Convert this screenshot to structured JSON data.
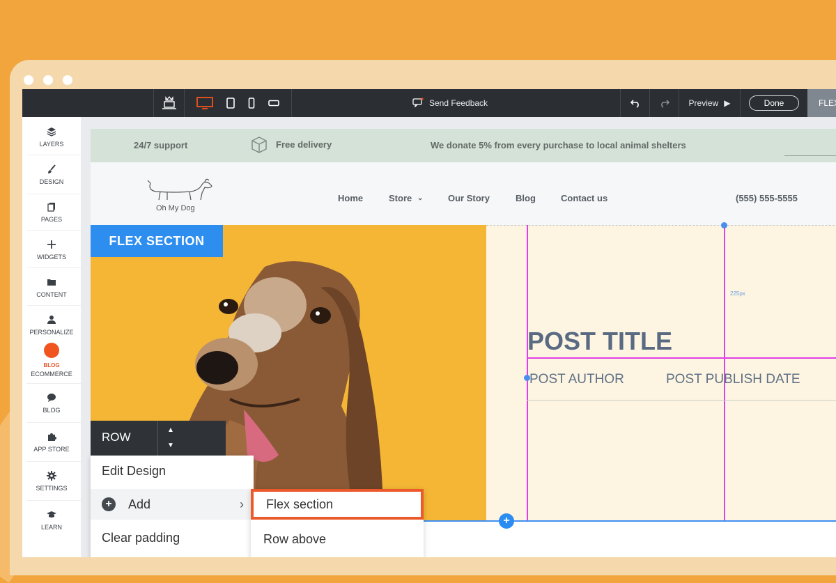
{
  "toolbar": {
    "feedback_label": "Send Feedback",
    "preview_label": "Preview",
    "done_label": "Done",
    "flex_tab_label": "FLEX",
    "device_icons": [
      "crown-desktop-icon",
      "desktop-icon",
      "tablet-icon",
      "mobile-icon",
      "landscape-icon"
    ],
    "active_device": "desktop",
    "accent_color": "#f0541f"
  },
  "sidebar": {
    "items": [
      {
        "label": "LAYERS",
        "icon": "layers-icon"
      },
      {
        "label": "DESIGN",
        "icon": "brush-icon"
      },
      {
        "label": "PAGES",
        "icon": "pages-icon"
      },
      {
        "label": "WIDGETS",
        "icon": "plus-icon"
      },
      {
        "label": "CONTENT",
        "icon": "folder-icon"
      },
      {
        "label": "PERSONALIZE",
        "icon": "person-icon"
      },
      {
        "label": "ECOMMERCE",
        "icon": "cart-icon"
      },
      {
        "label": "BLOG",
        "icon": "chat-bubble-icon"
      },
      {
        "label": "APP STORE",
        "icon": "puzzle-icon"
      },
      {
        "label": "SETTINGS",
        "icon": "gear-icon"
      },
      {
        "label": "LEARN",
        "icon": "graduation-cap-icon"
      }
    ],
    "blog_badge_label": "BLOG"
  },
  "site": {
    "topbar": {
      "support": "24/7 support",
      "delivery": "Free delivery",
      "donate": "We donate 5% from every purchase to local animal shelters"
    },
    "logo_text": "Oh My Dog",
    "nav": [
      "Home",
      "Store",
      "Our Story",
      "Blog",
      "Contact us"
    ],
    "phone": "(555) 555-5555",
    "flex_label": "FLEX SECTION",
    "post_title": "POST TITLE",
    "post_author": "POST AUTHOR",
    "post_date": "POST PUBLISH DATE",
    "guide_label": "225px"
  },
  "context_menu": {
    "row_label": "ROW",
    "items": [
      "Edit Design",
      "Add",
      "Clear padding"
    ],
    "submenu": [
      "Flex section",
      "Row above"
    ]
  }
}
